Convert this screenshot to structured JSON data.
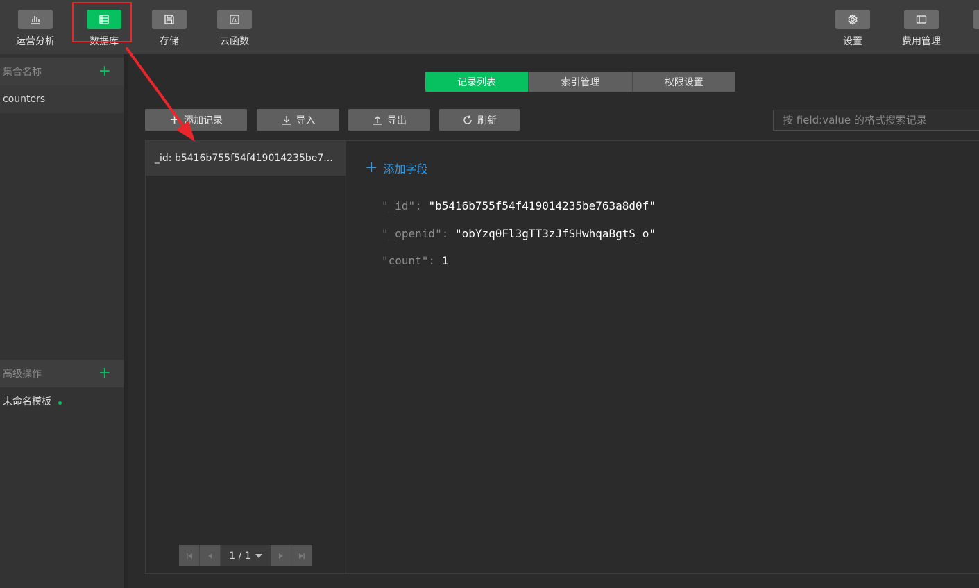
{
  "toolbar": {
    "items": [
      {
        "label": "运营分析",
        "icon": "chart-icon"
      },
      {
        "label": "数据库",
        "icon": "database-icon",
        "active": true
      },
      {
        "label": "存储",
        "icon": "save-icon"
      },
      {
        "label": "云函数",
        "icon": "function-icon"
      }
    ],
    "right_items": [
      {
        "label": "设置",
        "icon": "gear-icon"
      },
      {
        "label": "费用管理",
        "icon": "billing-icon"
      }
    ]
  },
  "sidebar": {
    "collections_header": "集合名称",
    "collections": [
      "counters"
    ],
    "advanced_header": "高级操作",
    "templates": [
      "未命名模板"
    ]
  },
  "tabs": [
    "记录列表",
    "索引管理",
    "权限设置"
  ],
  "actions": {
    "add_record": "添加记录",
    "import": "导入",
    "export": "导出",
    "refresh": "刷新"
  },
  "search": {
    "placeholder": "按 field:value 的格式搜索记录"
  },
  "records": {
    "items": [
      "_id: b5416b755f54f419014235be7..."
    ],
    "pager": "1 / 1"
  },
  "detail": {
    "add_field": "添加字段",
    "fields": [
      {
        "key": "\"_id\":",
        "value": "\"b5416b755f54f419014235be763a8d0f\""
      },
      {
        "key": "\"_openid\":",
        "value": "\"obYzq0Fl3gTT3zJfSHwhqaBgtS_o\""
      },
      {
        "key": "\"count\":",
        "value": "1"
      }
    ]
  },
  "colors": {
    "accent": "#07c160",
    "highlight": "#e8262b",
    "link": "#2f9be8"
  }
}
